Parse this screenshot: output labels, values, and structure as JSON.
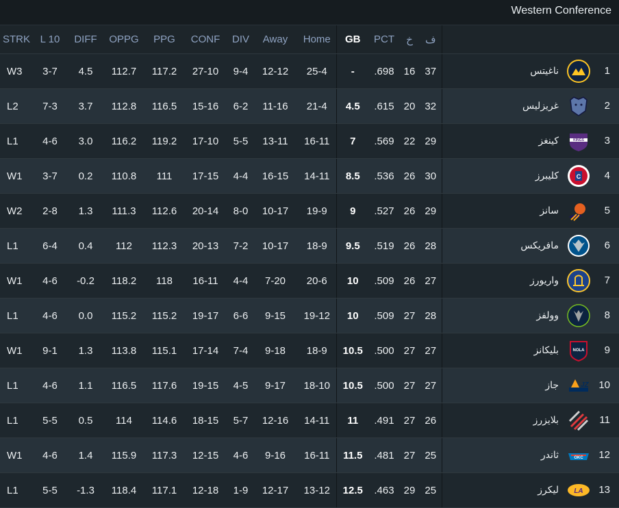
{
  "conference_title": "Western Conference",
  "columns": {
    "strk": "STRK",
    "l10": "L 10",
    "diff": "DIFF",
    "oppg": "OPPG",
    "ppg": "PPG",
    "conf": "CONF",
    "div": "DIV",
    "away": "Away",
    "home": "Home",
    "gb": "GB",
    "pct": "PCT",
    "losses": "خ",
    "wins": "ف"
  },
  "rows": [
    {
      "rank": "1",
      "team": "ناغيتس",
      "logo": "nuggets-logo",
      "wins": "37",
      "losses": "16",
      "pct": ".698",
      "gb": "-",
      "home": "25-4",
      "away": "12-12",
      "div": "9-4",
      "conf": "27-10",
      "ppg": "117.2",
      "oppg": "112.7",
      "diff": "4.5",
      "l10": "3-7",
      "strk": "W3"
    },
    {
      "rank": "2",
      "team": "غريزليس",
      "logo": "grizzlies-logo",
      "wins": "32",
      "losses": "20",
      "pct": ".615",
      "gb": "4.5",
      "home": "21-4",
      "away": "11-16",
      "div": "6-2",
      "conf": "15-16",
      "ppg": "116.5",
      "oppg": "112.8",
      "diff": "3.7",
      "l10": "7-3",
      "strk": "L2"
    },
    {
      "rank": "3",
      "team": "كينغز",
      "logo": "kings-logo",
      "wins": "29",
      "losses": "22",
      "pct": ".569",
      "gb": "7",
      "home": "16-11",
      "away": "13-11",
      "div": "5-5",
      "conf": "17-10",
      "ppg": "119.2",
      "oppg": "116.2",
      "diff": "3.0",
      "l10": "4-6",
      "strk": "L1"
    },
    {
      "rank": "4",
      "team": "كليبرز",
      "logo": "clippers-logo",
      "wins": "30",
      "losses": "26",
      "pct": ".536",
      "gb": "8.5",
      "home": "14-11",
      "away": "16-15",
      "div": "4-4",
      "conf": "17-15",
      "ppg": "111",
      "oppg": "110.8",
      "diff": "0.2",
      "l10": "3-7",
      "strk": "W1"
    },
    {
      "rank": "5",
      "team": "سانز",
      "logo": "suns-logo",
      "wins": "29",
      "losses": "26",
      "pct": ".527",
      "gb": "9",
      "home": "19-9",
      "away": "10-17",
      "div": "8-0",
      "conf": "20-14",
      "ppg": "112.6",
      "oppg": "111.3",
      "diff": "1.3",
      "l10": "2-8",
      "strk": "W2"
    },
    {
      "rank": "6",
      "team": "مافريكس",
      "logo": "mavericks-logo",
      "wins": "28",
      "losses": "26",
      "pct": ".519",
      "gb": "9.5",
      "home": "18-9",
      "away": "10-17",
      "div": "7-2",
      "conf": "20-13",
      "ppg": "112.3",
      "oppg": "112",
      "diff": "0.4",
      "l10": "6-4",
      "strk": "L1"
    },
    {
      "rank": "7",
      "team": "واريورز",
      "logo": "warriors-logo",
      "wins": "27",
      "losses": "26",
      "pct": ".509",
      "gb": "10",
      "home": "20-6",
      "away": "7-20",
      "div": "4-4",
      "conf": "16-11",
      "ppg": "118",
      "oppg": "118.2",
      "diff": "-0.2",
      "l10": "4-6",
      "strk": "W1"
    },
    {
      "rank": "8",
      "team": "وولفز",
      "logo": "timberwolves-logo",
      "wins": "28",
      "losses": "27",
      "pct": ".509",
      "gb": "10",
      "home": "19-12",
      "away": "9-15",
      "div": "6-6",
      "conf": "19-17",
      "ppg": "115.2",
      "oppg": "115.2",
      "diff": "0.0",
      "l10": "4-6",
      "strk": "L1"
    },
    {
      "rank": "9",
      "team": "بليكانز",
      "logo": "pelicans-logo",
      "wins": "27",
      "losses": "27",
      "pct": ".500",
      "gb": "10.5",
      "home": "18-9",
      "away": "9-18",
      "div": "7-4",
      "conf": "17-14",
      "ppg": "115.1",
      "oppg": "113.8",
      "diff": "1.3",
      "l10": "9-1",
      "strk": "W1"
    },
    {
      "rank": "10",
      "team": "جاز",
      "logo": "jazz-logo",
      "wins": "27",
      "losses": "27",
      "pct": ".500",
      "gb": "10.5",
      "home": "18-10",
      "away": "9-17",
      "div": "4-5",
      "conf": "19-15",
      "ppg": "117.6",
      "oppg": "116.5",
      "diff": "1.1",
      "l10": "4-6",
      "strk": "L1"
    },
    {
      "rank": "11",
      "team": "بلايزرز",
      "logo": "blazers-logo",
      "wins": "26",
      "losses": "27",
      "pct": ".491",
      "gb": "11",
      "home": "14-11",
      "away": "12-16",
      "div": "5-7",
      "conf": "18-15",
      "ppg": "114.6",
      "oppg": "114",
      "diff": "0.5",
      "l10": "5-5",
      "strk": "L1"
    },
    {
      "rank": "12",
      "team": "ثاندر",
      "logo": "thunder-logo",
      "wins": "25",
      "losses": "27",
      "pct": ".481",
      "gb": "11.5",
      "home": "16-11",
      "away": "9-16",
      "div": "4-6",
      "conf": "12-15",
      "ppg": "117.3",
      "oppg": "115.9",
      "diff": "1.4",
      "l10": "4-6",
      "strk": "W1"
    },
    {
      "rank": "13",
      "team": "ليكرز",
      "logo": "lakers-logo",
      "wins": "25",
      "losses": "29",
      "pct": ".463",
      "gb": "12.5",
      "home": "13-12",
      "away": "12-17",
      "div": "1-9",
      "conf": "12-18",
      "ppg": "117.1",
      "oppg": "118.4",
      "diff": "-1.3",
      "l10": "5-5",
      "strk": "L1"
    }
  ]
}
